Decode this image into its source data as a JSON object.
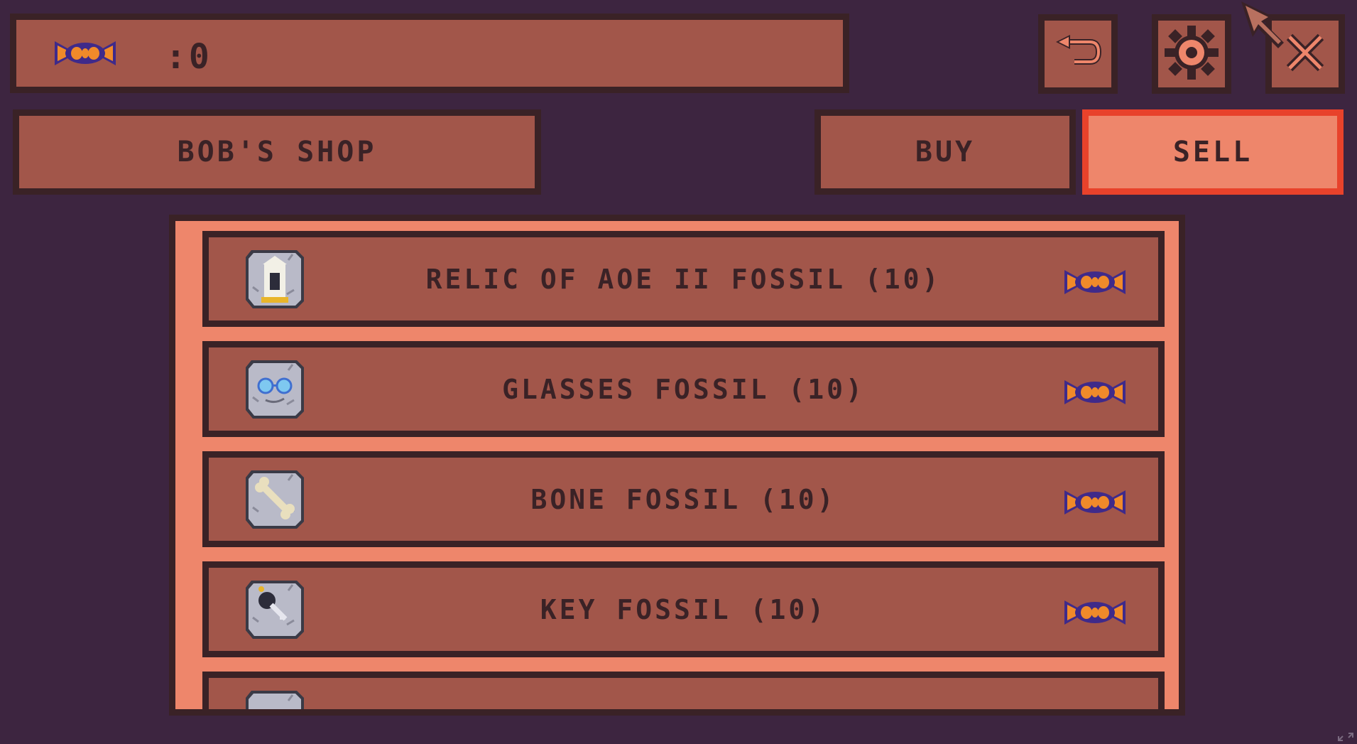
{
  "currency": {
    "amount": ":0",
    "icon": "candy-icon"
  },
  "toolbar": {
    "back_icon": "back-arrow-icon",
    "settings_icon": "gear-icon",
    "close_icon": "close-icon"
  },
  "shop": {
    "title": "BOB'S SHOP"
  },
  "tabs": {
    "buy": "BUY",
    "sell": "SELL",
    "active": "sell"
  },
  "items": [
    {
      "name": "RELIC OF AOE II FOSSIL (10)",
      "icon": "relic-fossil-icon",
      "price_icon": "candy-icon"
    },
    {
      "name": "GLASSES FOSSIL (10)",
      "icon": "glasses-fossil-icon",
      "price_icon": "candy-icon"
    },
    {
      "name": "BONE FOSSIL (10)",
      "icon": "bone-fossil-icon",
      "price_icon": "candy-icon"
    },
    {
      "name": "KEY FOSSIL (10)",
      "icon": "key-fossil-icon",
      "price_icon": "candy-icon"
    },
    {
      "name": "",
      "icon": "fossil-icon",
      "price_icon": "candy-icon"
    }
  ],
  "colors": {
    "background": "#3d2540",
    "panel": "#a2564a",
    "border": "#3a2226",
    "highlight": "#ee866b",
    "active_border": "#e8422b",
    "candy_orange": "#f08a2a",
    "candy_purple": "#3f2a8a"
  }
}
